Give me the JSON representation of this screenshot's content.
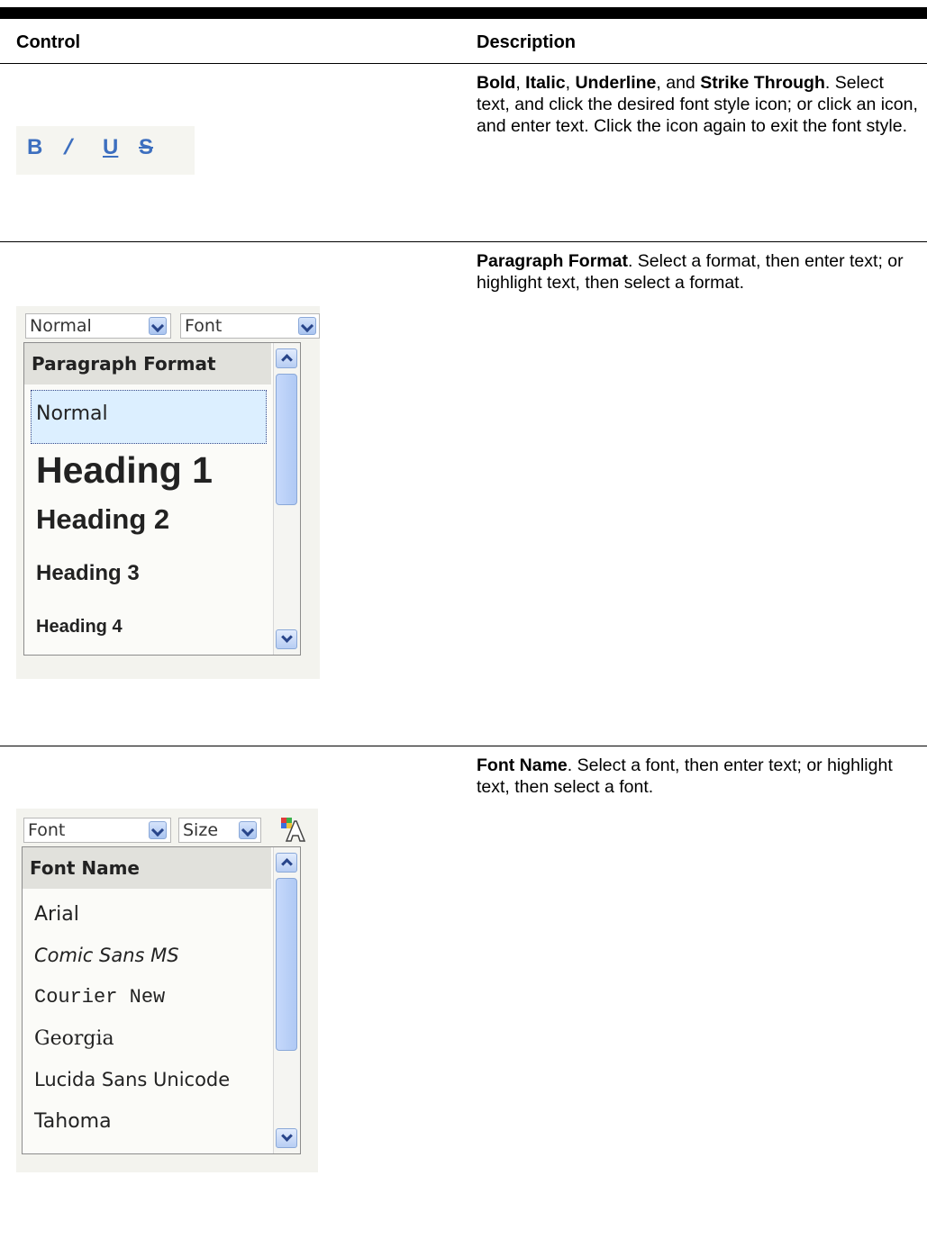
{
  "table": {
    "col_control": "Control",
    "col_description": "Description"
  },
  "row1": {
    "icons": [
      {
        "name": "bold-icon",
        "glyph": "B"
      },
      {
        "name": "italic-icon",
        "glyph": "/"
      },
      {
        "name": "underline-icon",
        "glyph": "U"
      },
      {
        "name": "strikethrough-icon",
        "glyph": "S"
      }
    ],
    "desc": {
      "b1": "Bold",
      "s1": ", ",
      "b2": "Italic",
      "s2": ", ",
      "b3": "Underline",
      "s3": ", and ",
      "b4": "Strike Through",
      "rest": ". Select text, and click the desired font style icon; or click an icon, and enter text. Click the icon again to exit the font style."
    }
  },
  "row2": {
    "combo1": "Normal",
    "combo2": "Font",
    "list_header": "Paragraph Format",
    "items": [
      "Normal",
      "Heading 1",
      "Heading 2",
      "Heading 3",
      "Heading 4"
    ],
    "desc": {
      "bold": "Paragraph Format",
      "rest": ". Select a format, then enter text; or highlight text, then select a format."
    }
  },
  "row3": {
    "combo1": "Font",
    "combo2": "Size",
    "list_header": "Font Name",
    "items": [
      "Arial",
      "Comic Sans MS",
      "Courier New",
      "Georgia",
      "Lucida Sans Unicode",
      "Tahoma"
    ],
    "desc": {
      "bold": "Font Name",
      "rest": ". Select a font, then enter text; or highlight text, then select a font."
    }
  }
}
